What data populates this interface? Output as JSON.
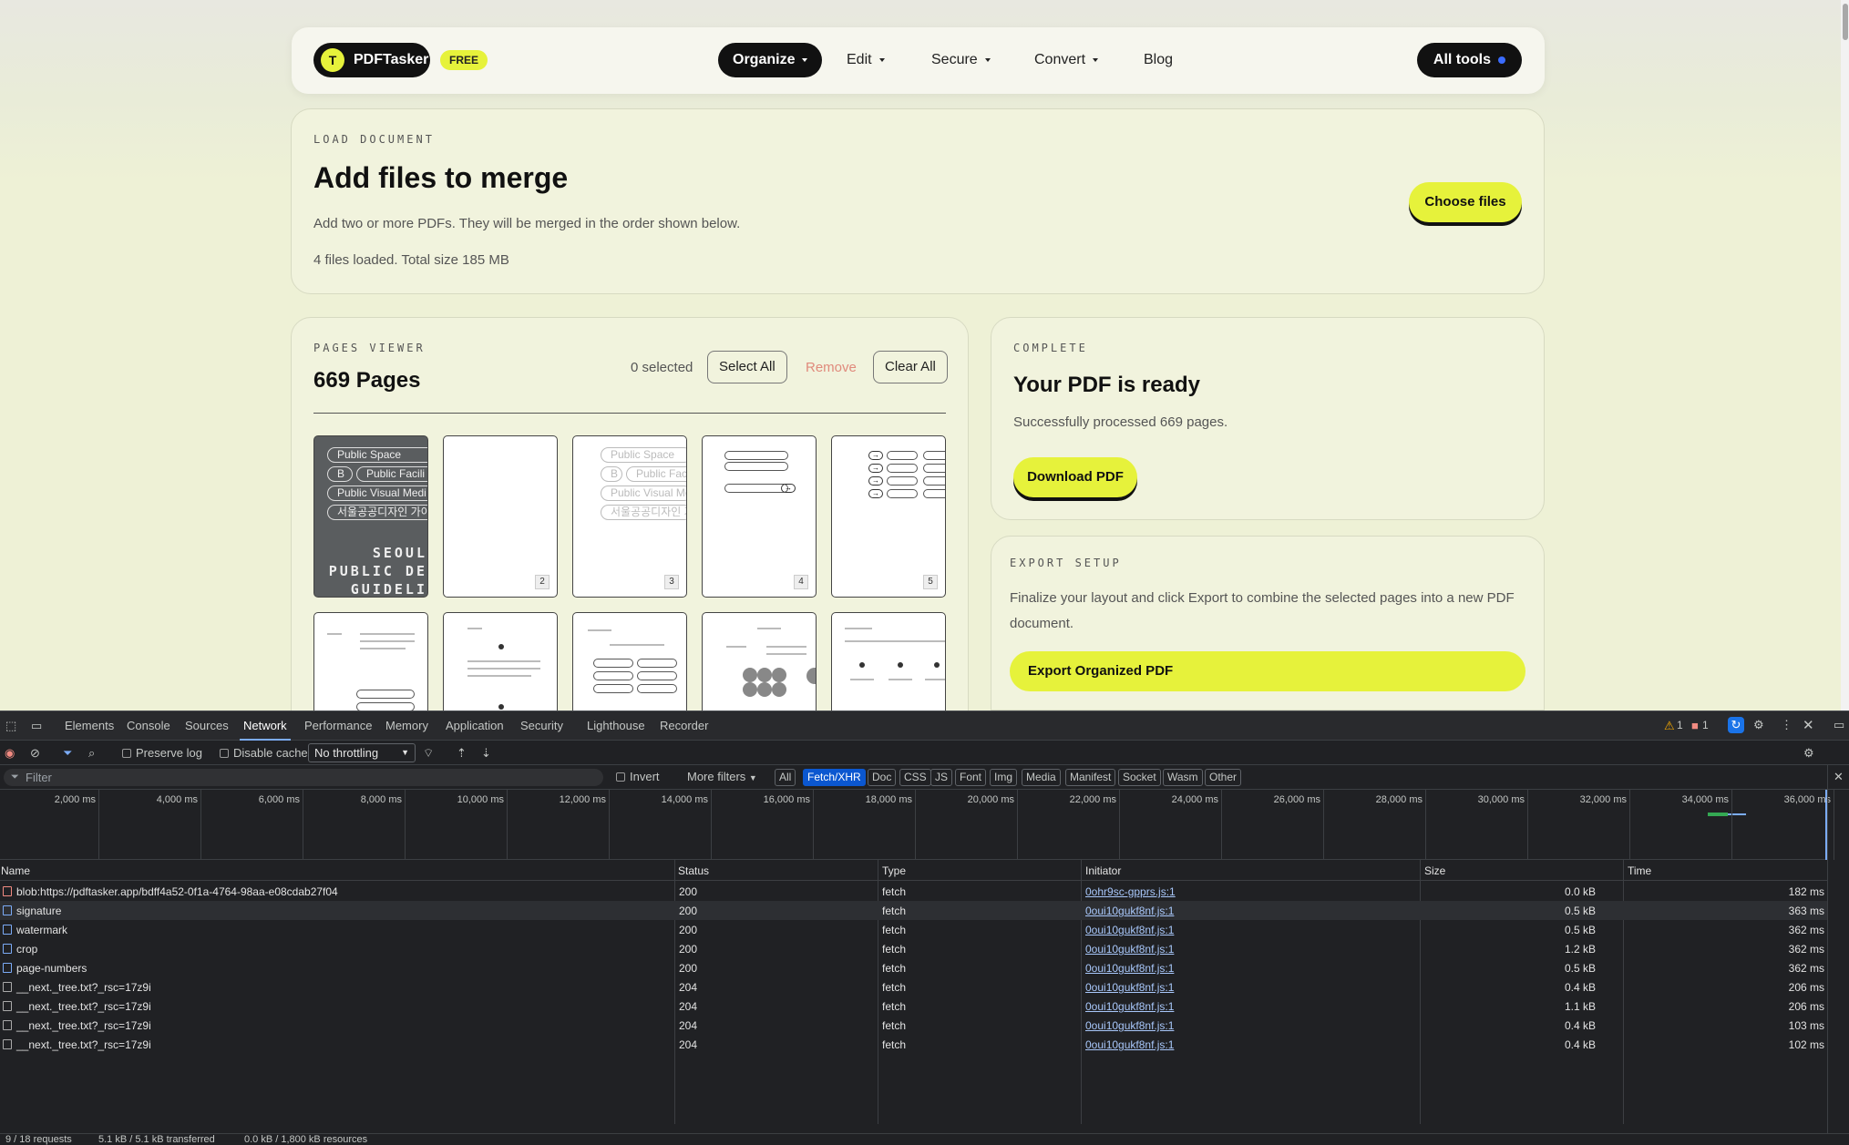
{
  "nav": {
    "logo_letter": "T",
    "brand": "PDFTasker",
    "badge": "FREE",
    "items": [
      {
        "label": "Organize",
        "active": true
      },
      {
        "label": "Edit"
      },
      {
        "label": "Secure"
      },
      {
        "label": "Convert"
      },
      {
        "label": "Blog"
      }
    ],
    "all_tools": "All tools"
  },
  "load": {
    "eyebrow": "LOAD DOCUMENT",
    "title": "Add files to merge",
    "desc": "Add two or more PDFs. They will be merged in the order shown below.",
    "status": "4 files loaded. Total size 185 MB",
    "button": "Choose files"
  },
  "viewer": {
    "eyebrow": "PAGES VIEWER",
    "title": "669 Pages",
    "selected": "0 selected",
    "select_all": "Select All",
    "remove": "Remove",
    "clear_all": "Clear All",
    "page1_pills": [
      "Public Space",
      "B",
      "Public Facili",
      "Public Visual Medi",
      "서울공공디자인 가이드"
    ],
    "page1_big": [
      "SEOUL",
      "PUBLIC DE",
      "GUIDELI"
    ],
    "page3_pills": [
      "Public Space",
      "B",
      "Public Facili",
      "Public Visual Med",
      "서울공공디자인 가이드"
    ],
    "page_numbers": [
      "2",
      "3",
      "4",
      "5"
    ]
  },
  "complete": {
    "eyebrow": "COMPLETE",
    "title": "Your PDF is ready",
    "desc": "Successfully processed 669 pages.",
    "button": "Download PDF"
  },
  "export": {
    "eyebrow": "EXPORT SETUP",
    "desc_line1": "Finalize your layout and click Export to combine the selected pages into a new PDF",
    "desc_line2": "document.",
    "button": "Export Organized PDF"
  },
  "devtools": {
    "tabs": [
      "Elements",
      "Console",
      "Sources",
      "Network",
      "Performance",
      "Memory",
      "Application",
      "Security",
      "Lighthouse",
      "Recorder"
    ],
    "active_tab": "Network",
    "warnings": "1",
    "errors": "1",
    "toolbar": {
      "preserve_log": "Preserve log",
      "disable_cache": "Disable cache",
      "throttling": "No throttling"
    },
    "filter": {
      "placeholder": "Filter",
      "invert": "Invert",
      "more_filters": "More filters",
      "types": [
        "All",
        "Fetch/XHR",
        "Doc",
        "CSS",
        "JS",
        "Font",
        "Img",
        "Media",
        "Manifest",
        "Socket",
        "Wasm",
        "Other"
      ],
      "active_type": "Fetch/XHR"
    },
    "timeline_ticks": [
      "2,000 ms",
      "4,000 ms",
      "6,000 ms",
      "8,000 ms",
      "10,000 ms",
      "12,000 ms",
      "14,000 ms",
      "16,000 ms",
      "18,000 ms",
      "20,000 ms",
      "22,000 ms",
      "24,000 ms",
      "26,000 ms",
      "28,000 ms",
      "30,000 ms",
      "32,000 ms",
      "34,000 ms",
      "36,000 ms"
    ],
    "columns": [
      "Name",
      "Status",
      "Type",
      "Initiator",
      "Size",
      "Time"
    ],
    "rows": [
      {
        "name": "blob:https://pdftasker.app/bdff4a52-0f1a-4764-98aa-e08cdab27f04",
        "status": "200",
        "type": "fetch",
        "initiator": "0ohr9sc-gpprs.js:1",
        "size": "0.0 kB",
        "time": "182 ms",
        "icon": "img"
      },
      {
        "name": "signature",
        "status": "200",
        "type": "fetch",
        "initiator": "0oui10gukf8nf.js:1",
        "size": "0.5 kB",
        "time": "363 ms",
        "icon": "fetch"
      },
      {
        "name": "watermark",
        "status": "200",
        "type": "fetch",
        "initiator": "0oui10gukf8nf.js:1",
        "size": "0.5 kB",
        "time": "362 ms",
        "icon": "fetch"
      },
      {
        "name": "crop",
        "status": "200",
        "type": "fetch",
        "initiator": "0oui10gukf8nf.js:1",
        "size": "1.2 kB",
        "time": "362 ms",
        "icon": "fetch"
      },
      {
        "name": "page-numbers",
        "status": "200",
        "type": "fetch",
        "initiator": "0oui10gukf8nf.js:1",
        "size": "0.5 kB",
        "time": "362 ms",
        "icon": "fetch"
      },
      {
        "name": "__next._tree.txt?_rsc=17z9i",
        "status": "204",
        "type": "fetch",
        "initiator": "0oui10gukf8nf.js:1",
        "size": "0.4 kB",
        "time": "206 ms",
        "icon": "doc"
      },
      {
        "name": "__next._tree.txt?_rsc=17z9i",
        "status": "204",
        "type": "fetch",
        "initiator": "0oui10gukf8nf.js:1",
        "size": "1.1 kB",
        "time": "206 ms",
        "icon": "doc"
      },
      {
        "name": "__next._tree.txt?_rsc=17z9i",
        "status": "204",
        "type": "fetch",
        "initiator": "0oui10gukf8nf.js:1",
        "size": "0.4 kB",
        "time": "103 ms",
        "icon": "doc"
      },
      {
        "name": "__next._tree.txt?_rsc=17z9i",
        "status": "204",
        "type": "fetch",
        "initiator": "0oui10gukf8nf.js:1",
        "size": "0.4 kB",
        "time": "102 ms",
        "icon": "doc"
      }
    ],
    "status_bar": {
      "requests": "9 / 18 requests",
      "transferred": "5.1 kB / 5.1 kB transferred",
      "resources": "0.0 kB / 1,800 kB resources"
    }
  }
}
